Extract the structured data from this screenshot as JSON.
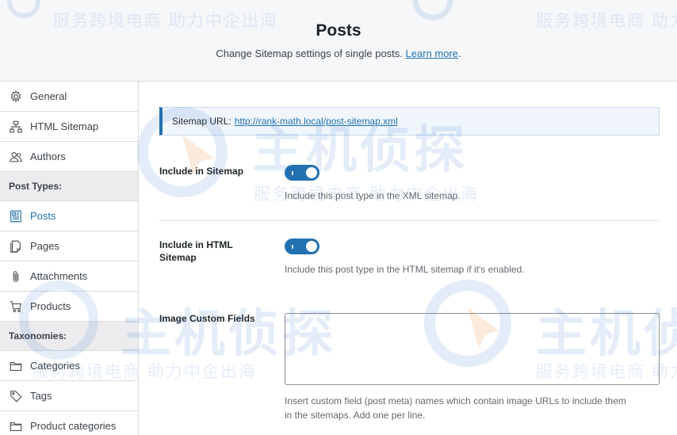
{
  "header": {
    "title": "Posts",
    "subtitle": "Change Sitemap settings of single posts.",
    "learn_more": "Learn more",
    "period": "."
  },
  "sidebar": {
    "items": [
      {
        "label": "General",
        "icon": "gear-icon"
      },
      {
        "label": "HTML Sitemap",
        "icon": "sitemap-icon"
      },
      {
        "label": "Authors",
        "icon": "users-icon"
      }
    ],
    "post_types_heading": "Post Types:",
    "post_types": [
      {
        "label": "Posts",
        "icon": "post-icon",
        "active": true
      },
      {
        "label": "Pages",
        "icon": "page-icon"
      },
      {
        "label": "Attachments",
        "icon": "paperclip-icon"
      },
      {
        "label": "Products",
        "icon": "cart-icon"
      }
    ],
    "taxonomies_heading": "Taxonomies:",
    "taxonomies": [
      {
        "label": "Categories",
        "icon": "folder-icon"
      },
      {
        "label": "Tags",
        "icon": "tag-icon"
      },
      {
        "label": "Product categories",
        "icon": "folder-icon"
      }
    ]
  },
  "main": {
    "sitemap_url_label": "Sitemap URL:",
    "sitemap_url": "http://rank-math.local/post-sitemap.xml",
    "include_sitemap": {
      "label": "Include in Sitemap",
      "enabled": true,
      "description": "Include this post type in the XML sitemap."
    },
    "include_html": {
      "label_line1": "Include in HTML",
      "label_line2": "Sitemap",
      "enabled": true,
      "description": "Include this post type in the HTML sitemap if it's enabled."
    },
    "image_custom_fields": {
      "label": "Image Custom Fields",
      "value": "",
      "description_line1": "Insert custom field (post meta) names which contain image URLs to include them",
      "description_line2": "in the sitemaps. Add one per line."
    }
  },
  "watermark": {
    "slogan": "服务跨境电商 助力中企出海",
    "brand": "主机侦探"
  },
  "colors": {
    "accent": "#2271b1",
    "toggle_on": "#2271b1",
    "sidebar_bg": "#f6f7f9",
    "notice_bg": "#f0f6fc"
  }
}
